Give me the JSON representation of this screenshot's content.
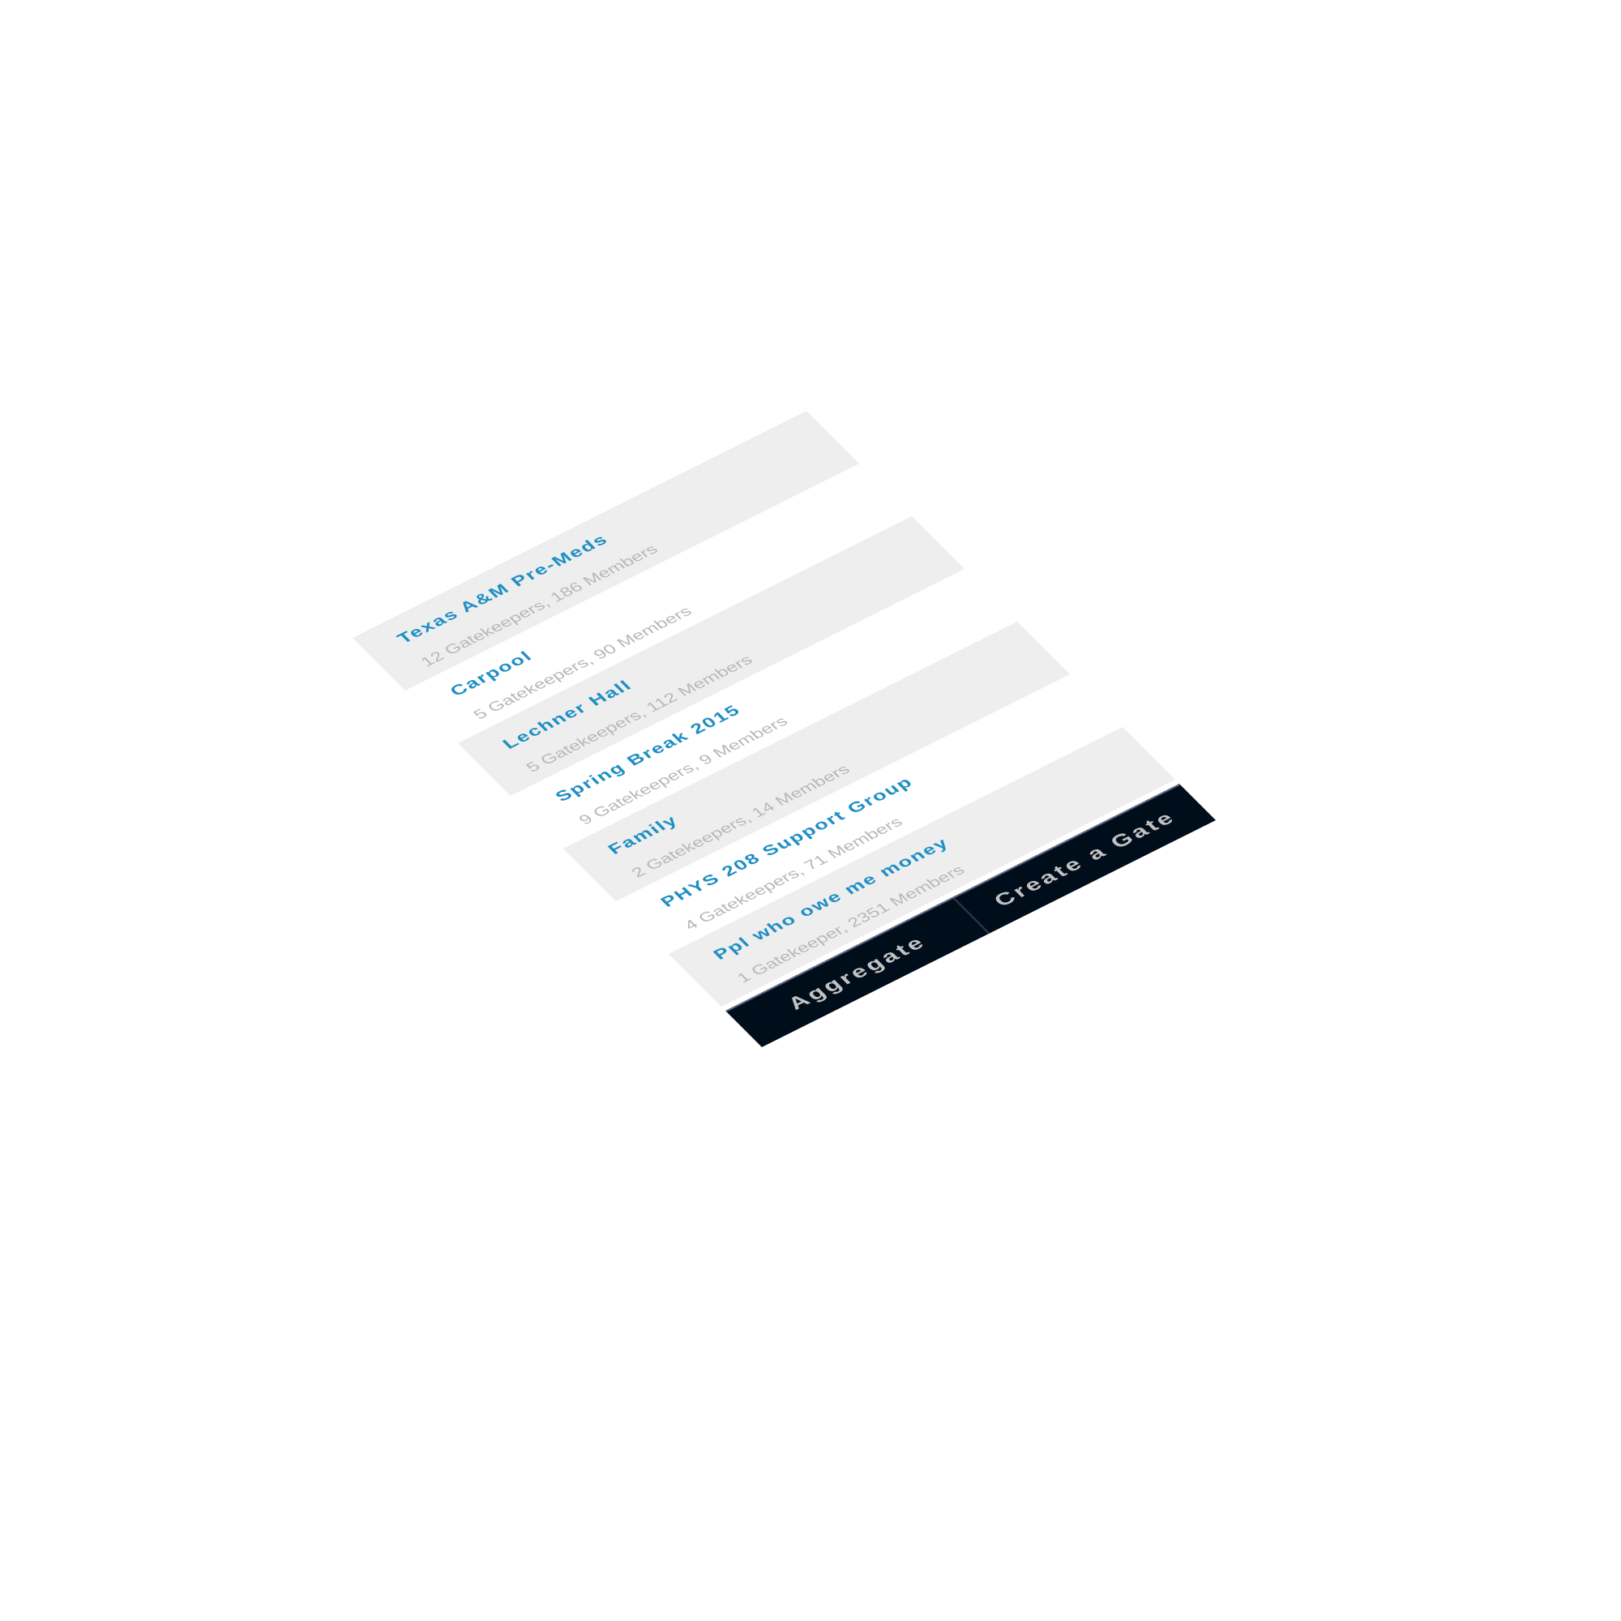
{
  "colors": {
    "page_background": "#ffffff",
    "row_alt_background": "#eeeeee",
    "group_name": "#1f8fc4",
    "group_meta": "#b8b8b8",
    "action_bar_background": "#000d1b",
    "action_bar_border": "#5d6b85",
    "action_button_text": "#c2c2c2"
  },
  "groups": [
    {
      "name": "Texas A&M Pre-Meds",
      "meta": "12 Gatekeepers, 186 Members"
    },
    {
      "name": "Carpool",
      "meta": "5 Gatekeepers, 90 Members"
    },
    {
      "name": "Lechner Hall",
      "meta": "5 Gatekeepers, 112 Members"
    },
    {
      "name": "Spring Break 2015",
      "meta": "9 Gatekeepers, 9 Members"
    },
    {
      "name": "Family",
      "meta": "2 Gatekeepers, 14 Members"
    },
    {
      "name": "PHYS 208 Support Group",
      "meta": "4 Gatekeepers, 71 Members"
    },
    {
      "name": "Ppl who owe me money",
      "meta": "1 Gatekeeper, 2351 Members"
    }
  ],
  "actions": {
    "aggregate_label": "Aggregate",
    "create_gate_label": "Create a Gate"
  }
}
